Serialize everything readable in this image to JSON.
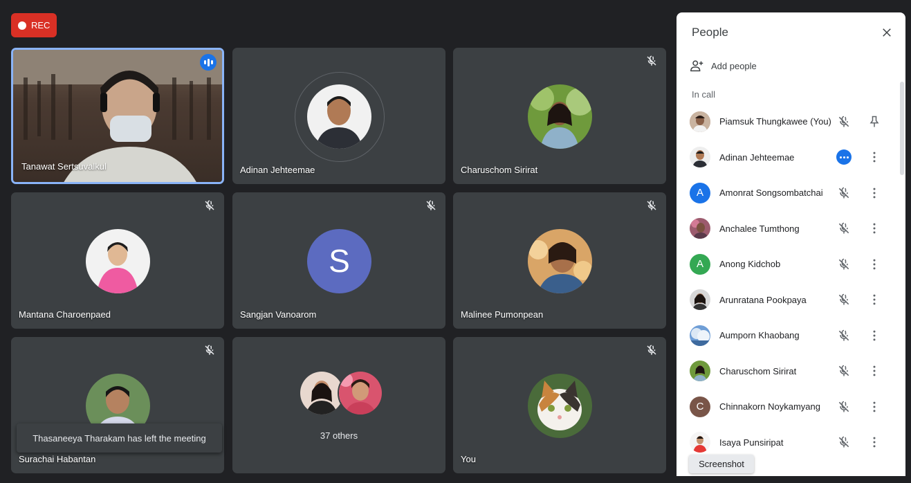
{
  "rec_label": "REC",
  "tiles": [
    {
      "name": "Tanawat Sertsuvalkul",
      "type": "video",
      "speaking": true
    },
    {
      "name": "Adinan Jehteemae",
      "type": "photo"
    },
    {
      "name": "Charuschom Sirirat",
      "type": "photo",
      "muted": true
    },
    {
      "name": "Mantana Charoenpaed",
      "type": "photo",
      "muted": true
    },
    {
      "name": "Sangjan Vanoarom",
      "type": "letter",
      "letter": "S",
      "muted": true
    },
    {
      "name": "Malinee Pumonpean",
      "type": "photo",
      "muted": true
    },
    {
      "name": "Surachai Habantan",
      "type": "photo",
      "muted": true
    },
    {
      "name": "37 others",
      "type": "group"
    },
    {
      "name": "You",
      "type": "photo",
      "muted": true
    }
  ],
  "toast": "Thasaneeya Tharakam has left the meeting",
  "panel": {
    "title": "People",
    "add_people": "Add people",
    "in_call": "In call",
    "participants": [
      {
        "name": "Piamsuk Thungkawee (You)",
        "avatar": "photo",
        "action": "pin-icon"
      },
      {
        "name": "Adinan Jehteemae",
        "avatar": "photo",
        "status": "more-options-active"
      },
      {
        "name": "Amonrat Songsombatchai",
        "avatar": "letter",
        "letter": "A",
        "color": "#1a73e8"
      },
      {
        "name": "Anchalee Tumthong",
        "avatar": "photo"
      },
      {
        "name": "Anong Kidchob",
        "avatar": "letter",
        "letter": "A",
        "color": "#34a853"
      },
      {
        "name": "Arunratana Pookpaya",
        "avatar": "photo"
      },
      {
        "name": "Aumporn Khaobang",
        "avatar": "photo"
      },
      {
        "name": "Charuschom Sirirat",
        "avatar": "photo"
      },
      {
        "name": "Chinnakorn Noykamyang",
        "avatar": "letter",
        "letter": "C",
        "color": "#795548"
      },
      {
        "name": "Isaya Punsiripat",
        "avatar": "photo"
      }
    ]
  },
  "tooltip": "Screenshot"
}
